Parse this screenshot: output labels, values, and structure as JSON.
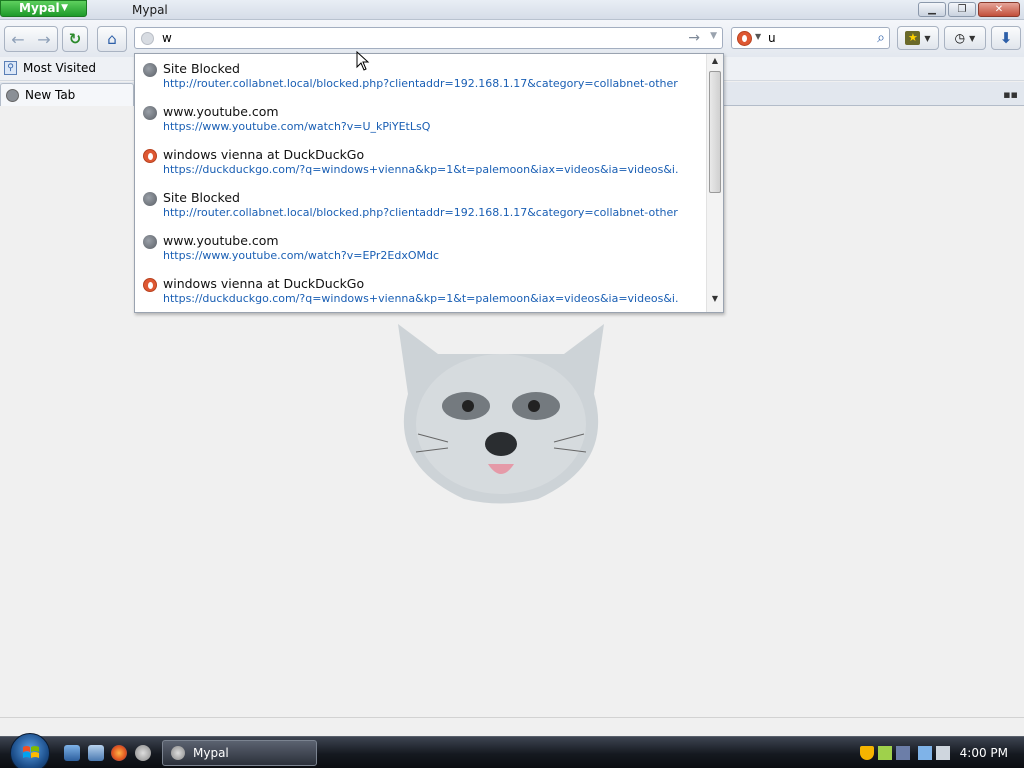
{
  "window": {
    "app_menu_label": "Mypal",
    "title": "Mypal"
  },
  "navbar": {
    "url_value": "w",
    "search_value": "u",
    "search_engine": "DuckDuckGo"
  },
  "bookmarks": {
    "items": [
      {
        "label": "Most Visited"
      }
    ]
  },
  "tabs": [
    {
      "label": "New Tab"
    }
  ],
  "autocomplete": {
    "rows": [
      {
        "icon": "globe-icon",
        "title": "Site Blocked",
        "url": "http://router.collabnet.local/blocked.php?clientaddr=192.168.1.17&category=collabnet-other&..."
      },
      {
        "icon": "globe-icon",
        "title": "www.youtube.com",
        "url": "https://www.youtube.com/watch?v=U_kPiYEtLsQ"
      },
      {
        "icon": "duckduckgo-icon",
        "title": "windows vienna at DuckDuckGo",
        "url": "https://duckduckgo.com/?q=windows+vienna&kp=1&t=palemoon&iax=videos&ia=videos&i..."
      },
      {
        "icon": "globe-icon",
        "title": "Site Blocked",
        "url": "http://router.collabnet.local/blocked.php?clientaddr=192.168.1.17&category=collabnet-other&..."
      },
      {
        "icon": "globe-icon",
        "title": "www.youtube.com",
        "url": "https://www.youtube.com/watch?v=EPr2EdxOMdc"
      },
      {
        "icon": "duckduckgo-icon",
        "title": "windows vienna at DuckDuckGo",
        "url": "https://duckduckgo.com/?q=windows+vienna&kp=1&t=palemoon&iax=videos&ia=videos&i..."
      }
    ]
  },
  "taskbar": {
    "active_window_label": "Mypal",
    "clock": "4:00 PM"
  },
  "colors": {
    "app_menu_green": "#1e9a2a",
    "link_blue": "#1a5fb4",
    "ddg_orange": "#de5833"
  }
}
